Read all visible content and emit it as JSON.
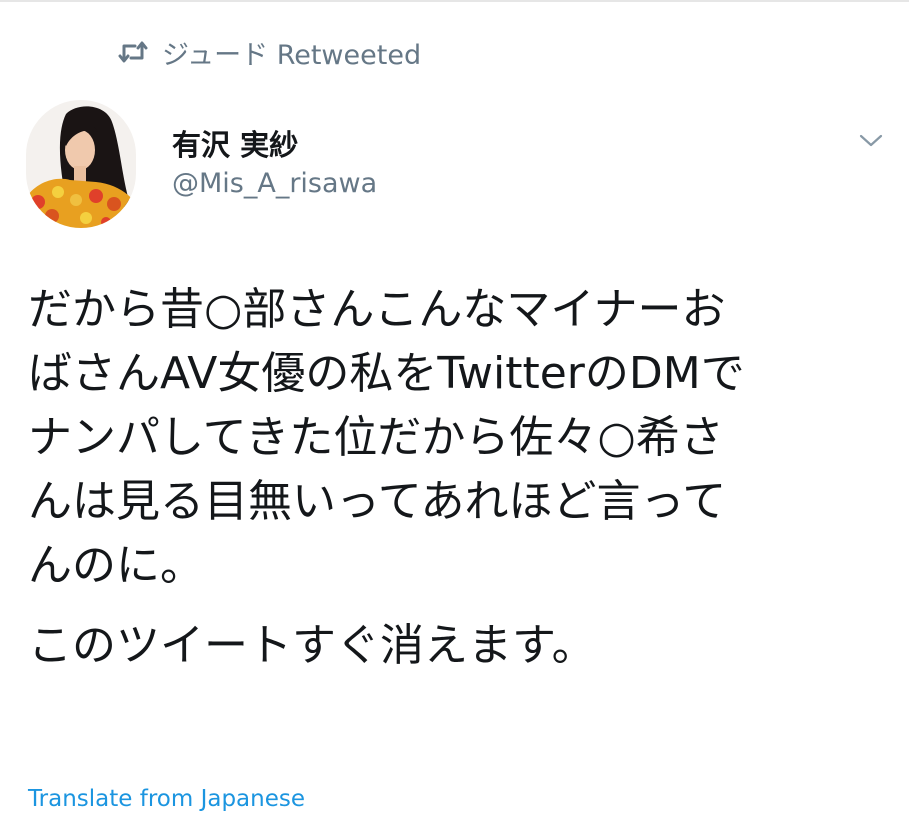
{
  "retweet_context": {
    "icon": "retweet-icon",
    "text": "ジュード Retweeted"
  },
  "author": {
    "name": "有沢 実紗",
    "handle": "@Mis_A_risawa",
    "avatar": "avatar"
  },
  "caret_icon": "chevron-down-icon",
  "tweet": {
    "paragraph1_lines": [
      "だから昔○部さんこんなマイナーお",
      "ばさんAV女優の私をTwitterのDMで",
      "ナンパしてきた位だから佐々○希さ",
      "んは見る目無いってあれほど言って",
      "んのに。"
    ],
    "paragraph2": "このツイートすぐ消えます。"
  },
  "translate_label": "Translate from Japanese",
  "colors": {
    "text": "#14171a",
    "secondary": "#657786",
    "link": "#1b95e0"
  }
}
